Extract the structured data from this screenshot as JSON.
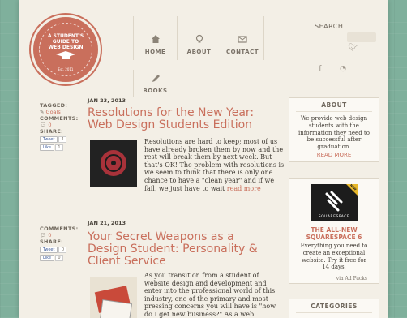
{
  "badge": {
    "line1": "A STUDENT'S",
    "line2": "GUIDE TO",
    "line3": "WEB DESIGN",
    "est": "Est. 2011"
  },
  "nav": [
    {
      "label": "HOME",
      "icon": "home-icon"
    },
    {
      "label": "ABOUT",
      "icon": "lightbulb-icon"
    },
    {
      "label": "CONTACT",
      "icon": "envelope-icon"
    },
    {
      "label": "BOOKS",
      "icon": "pencil-icon"
    }
  ],
  "search": {
    "label": "SEARCH..."
  },
  "posts": [
    {
      "date": "JAN 23, 2013",
      "title": "Resolutions for the New Year: Web Design Students Edition",
      "excerpt": "Resolutions are hard to keep; most of us have already broken them by now and the rest will break them by next week. But that's OK! The problem with resolutions is we seem to think that there is only one chance to have a \"clean year\" and if we fail, we just have to wait",
      "more": "read more",
      "tagged_label": "TAGGED:",
      "tag": "Goals",
      "comments_label": "COMMENTS:",
      "comments": "0",
      "share_label": "SHARE:",
      "tweet": "Tweet",
      "tweet_count": "1",
      "like": "Like",
      "like_count": "1"
    },
    {
      "date": "JAN 21, 2013",
      "title": "Your Secret Weapons as a Design Student: Personality & Client Service",
      "excerpt": "As you transition from a student of website design and development and enter into the professional world of this industry, one of the primary and most pressing concerns you will have is \"how do I get new business?\" As a web",
      "comments_label": "COMMENTS:",
      "comments": "0",
      "share_label": "SHARE:",
      "tweet": "Tweet",
      "tweet_count": "0",
      "like": "Like",
      "like_count": "0"
    }
  ],
  "sidebar": {
    "about_title": "ABOUT",
    "about_text": "We provide web design students with the information they need to be successful after graduation.",
    "about_more": "READ MORE",
    "ad_brand": "SQUARESPACE",
    "ad_ribbon": "NEW",
    "ad_title": "THE ALL-NEW SQUARESPACE 6",
    "ad_text": "Everything you need to create an exceptional website. Try it free for 14 days.",
    "ad_via": "via Ad Packs",
    "categories_title": "CATEGORIES"
  },
  "colors": {
    "accent": "#c96f5c",
    "background": "#7fb09c",
    "paper": "#f3efe6"
  }
}
